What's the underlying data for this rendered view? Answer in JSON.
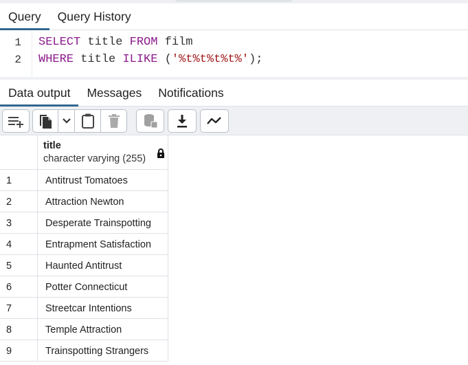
{
  "query_tabs": [
    {
      "label": "Query",
      "active": true
    },
    {
      "label": "Query History",
      "active": false
    }
  ],
  "editor": {
    "lines": [
      {
        "number": "1",
        "tokens": [
          {
            "text": "SELECT",
            "kind": "kw"
          },
          {
            "text": " title ",
            "kind": "plain"
          },
          {
            "text": "FROM",
            "kind": "kw"
          },
          {
            "text": " film",
            "kind": "plain"
          }
        ]
      },
      {
        "number": "2",
        "tokens": [
          {
            "text": "WHERE",
            "kind": "kw"
          },
          {
            "text": " title ",
            "kind": "plain"
          },
          {
            "text": "ILIKE",
            "kind": "kw"
          },
          {
            "text": " (",
            "kind": "plain"
          },
          {
            "text": "'%t%t%t%t%'",
            "kind": "str"
          },
          {
            "text": ");",
            "kind": "plain"
          }
        ]
      }
    ]
  },
  "output_tabs": [
    {
      "label": "Data output",
      "active": true
    },
    {
      "label": "Messages",
      "active": false
    },
    {
      "label": "Notifications",
      "active": false
    }
  ],
  "toolbar": {
    "icons": [
      "add-row-icon",
      "copy-icon",
      "chevron-down-icon",
      "paste-icon",
      "delete-icon",
      "save-data-icon",
      "download-icon",
      "graph-icon"
    ]
  },
  "grid": {
    "column": {
      "name": "title",
      "type": "character varying (255)",
      "icon": "lock-icon"
    },
    "rows": [
      {
        "num": "1",
        "title": "Antitrust Tomatoes"
      },
      {
        "num": "2",
        "title": "Attraction Newton"
      },
      {
        "num": "3",
        "title": "Desperate Trainspotting"
      },
      {
        "num": "4",
        "title": "Entrapment Satisfaction"
      },
      {
        "num": "5",
        "title": "Haunted Antitrust"
      },
      {
        "num": "6",
        "title": "Potter Connecticut"
      },
      {
        "num": "7",
        "title": "Streetcar Intentions"
      },
      {
        "num": "8",
        "title": "Temple Attraction"
      },
      {
        "num": "9",
        "title": "Trainspotting Strangers"
      }
    ]
  },
  "colors": {
    "accent": "#326690",
    "keyword": "#8b1a8b",
    "string": "#a21a1a",
    "toolbar_bg": "#eef0f3"
  }
}
